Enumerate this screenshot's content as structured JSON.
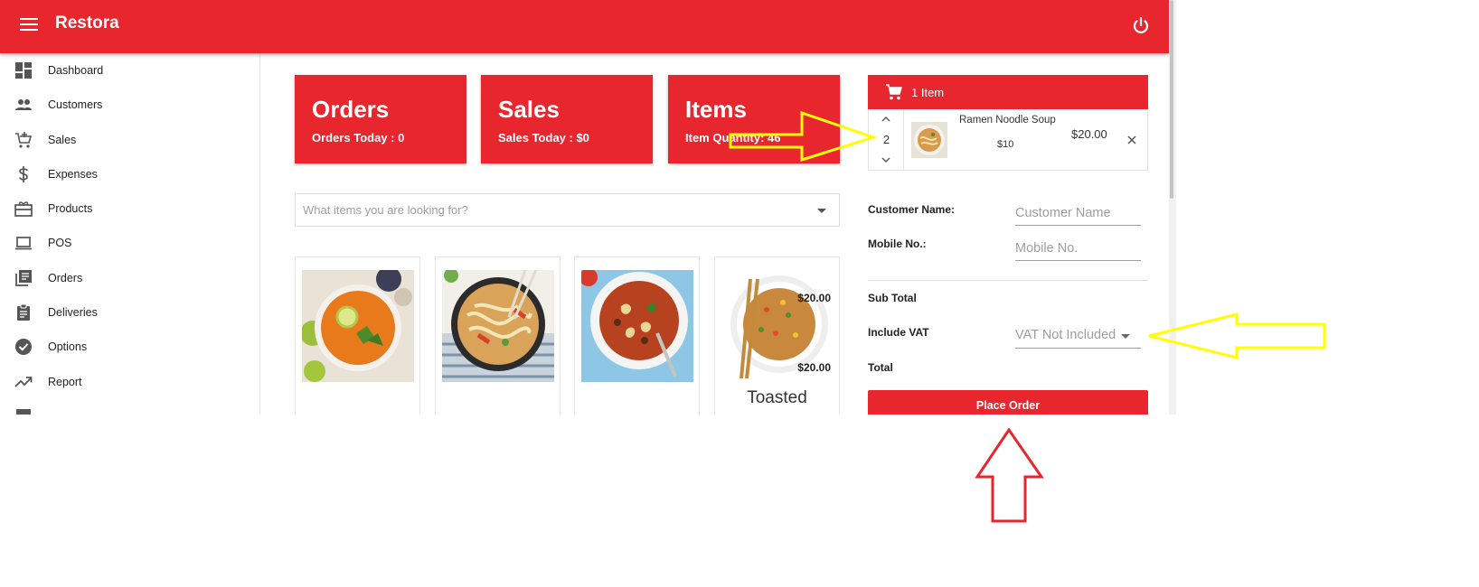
{
  "app": {
    "title": "Restora"
  },
  "header": {
    "menu_icon": "hamburger-menu-icon",
    "power_icon": "power-icon",
    "accent": "#e8262e"
  },
  "sidebar": {
    "items": [
      {
        "label": "Dashboard",
        "icon": "dashboard-icon"
      },
      {
        "label": "Customers",
        "icon": "people-icon"
      },
      {
        "label": "Sales",
        "icon": "add-shopping-cart-icon"
      },
      {
        "label": "Expenses",
        "icon": "dollar-icon"
      },
      {
        "label": "Products",
        "icon": "card-giftcard-icon"
      },
      {
        "label": "POS",
        "icon": "laptop-icon"
      },
      {
        "label": "Orders",
        "icon": "library-books-icon"
      },
      {
        "label": "Deliveries",
        "icon": "assignment-icon"
      },
      {
        "label": "Options",
        "icon": "check-circle-icon"
      },
      {
        "label": "Report",
        "icon": "trending-up-icon"
      }
    ]
  },
  "stats": [
    {
      "title": "Orders",
      "sub": "Orders Today : 0"
    },
    {
      "title": "Sales",
      "sub": "Sales Today : $0"
    },
    {
      "title": "Items",
      "sub": "Item Quantity: 46"
    }
  ],
  "search": {
    "placeholder": "What items you are looking for?"
  },
  "products": [
    {
      "name": "",
      "image": "thai-curry-soup"
    },
    {
      "name": "",
      "image": "ramen-noodle-soup"
    },
    {
      "name": "",
      "image": "minestrone-soup"
    },
    {
      "name": "Toasted",
      "image": "fried-rice"
    }
  ],
  "cart": {
    "count_label": "1 Item",
    "items": [
      {
        "name": "Ramen Noodle Soup",
        "unit_price": "$10",
        "total": "$20.00",
        "qty": "2"
      }
    ]
  },
  "form": {
    "customer_label": "Customer Name:",
    "customer_placeholder": "Customer Name",
    "mobile_label": "Mobile No.:",
    "mobile_placeholder": "Mobile No."
  },
  "summary": {
    "subtotal_label": "Sub Total",
    "subtotal_value": "$20.00",
    "vat_label": "Include VAT",
    "vat_value": "VAT Not Included",
    "total_label": "Total",
    "total_value": "$20.00"
  },
  "actions": {
    "place_order": "Place Order"
  },
  "annotations": {
    "yellow": "#ffff00",
    "red": "#e8262e"
  }
}
